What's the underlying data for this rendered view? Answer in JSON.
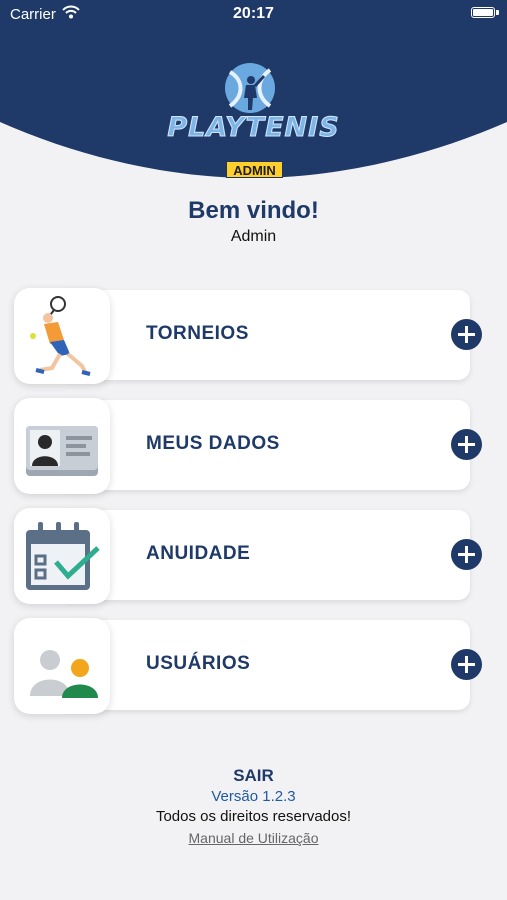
{
  "status_bar": {
    "carrier": "Carrier",
    "time": "20:17"
  },
  "header": {
    "logo_text": "PLAYTENIS",
    "badge": "ADMIN",
    "brand_color": "#1f3a68",
    "badge_color": "#ffcf2e"
  },
  "welcome": {
    "title": "Bem vindo!",
    "user": "Admin"
  },
  "menu": [
    {
      "label": "TORNEIOS",
      "icon": "tennis-player-icon"
    },
    {
      "label": "MEUS DADOS",
      "icon": "id-card-icon"
    },
    {
      "label": "ANUIDADE",
      "icon": "calendar-check-icon"
    },
    {
      "label": "USUÁRIOS",
      "icon": "users-icon"
    }
  ],
  "footer": {
    "logout": "SAIR",
    "version": "Versão 1.2.3",
    "rights": "Todos os direitos reservados!",
    "manual": "Manual de Utilização"
  }
}
